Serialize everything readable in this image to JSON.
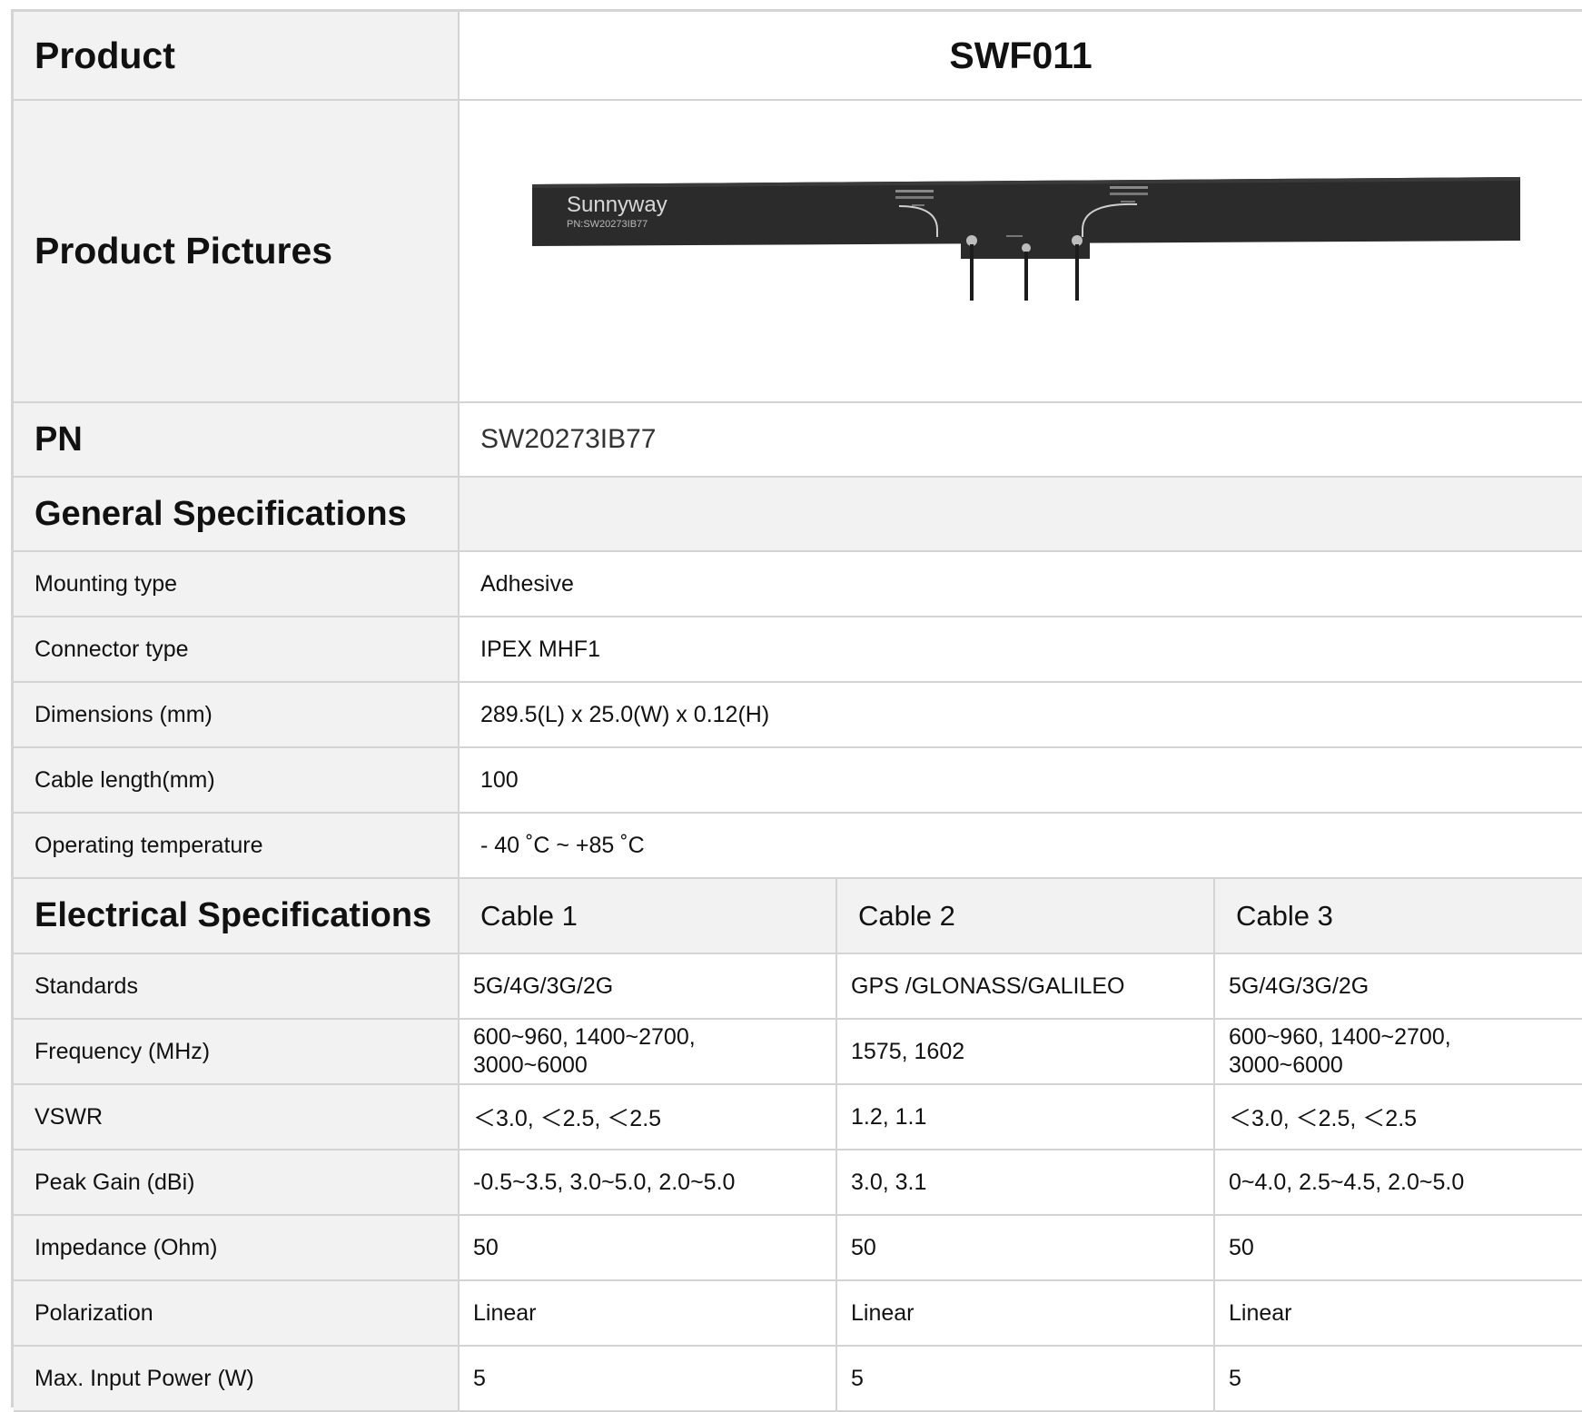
{
  "header": {
    "product_label": "Product",
    "product_value": "SWF011"
  },
  "pictures": {
    "label": "Product Pictures",
    "antenna_brand": "Sunnyway",
    "antenna_pn": "PN:SW20273IB77"
  },
  "pn": {
    "label": "PN",
    "value": "SW20273IB77"
  },
  "general": {
    "title": "General Specifications",
    "rows": [
      {
        "label": "Mounting type",
        "value": "Adhesive"
      },
      {
        "label": "Connector type",
        "value": "IPEX MHF1"
      },
      {
        "label": "Dimensions (mm)",
        "value": "289.5(L) x 25.0(W) x 0.12(H)"
      },
      {
        "label": "Cable length(mm)",
        "value": "100"
      },
      {
        "label": "Operating temperature",
        "value": "- 40 ˚C ~ +85 ˚C"
      }
    ]
  },
  "electrical": {
    "title": "Electrical Specifications",
    "columns": [
      "Cable 1",
      "Cable 2",
      "Cable 3"
    ],
    "rows": [
      {
        "label": "Standards",
        "c1": "5G/4G/3G/2G",
        "c2": "GPS /GLONASS/GALILEO",
        "c3": "5G/4G/3G/2G"
      },
      {
        "label": "Frequency (MHz)",
        "c1a": "600~960,  1400~2700,",
        "c1b": "3000~6000",
        "c2": "1575,  1602",
        "c3a": "600~960, 1400~2700,",
        "c3b": "3000~6000"
      },
      {
        "label": "VSWR",
        "c1": "＜3.0,  ＜2.5,  ＜2.5",
        "c2": "1.2,  1.1",
        "c3": "＜3.0,  ＜2.5,  ＜2.5"
      },
      {
        "label": "Peak Gain (dBi)",
        "c1": "-0.5~3.5,  3.0~5.0,  2.0~5.0",
        "c2": "3.0,  3.1",
        "c3": "0~4.0,  2.5~4.5,  2.0~5.0"
      },
      {
        "label": "Impedance (Ohm)",
        "c1": "50",
        "c2": "50",
        "c3": "50"
      },
      {
        "label": "Polarization",
        "c1": "Linear",
        "c2": "Linear",
        "c3": "Linear"
      },
      {
        "label": "Max. Input Power (W)",
        "c1": "5",
        "c2": "5",
        "c3": "5"
      }
    ]
  }
}
